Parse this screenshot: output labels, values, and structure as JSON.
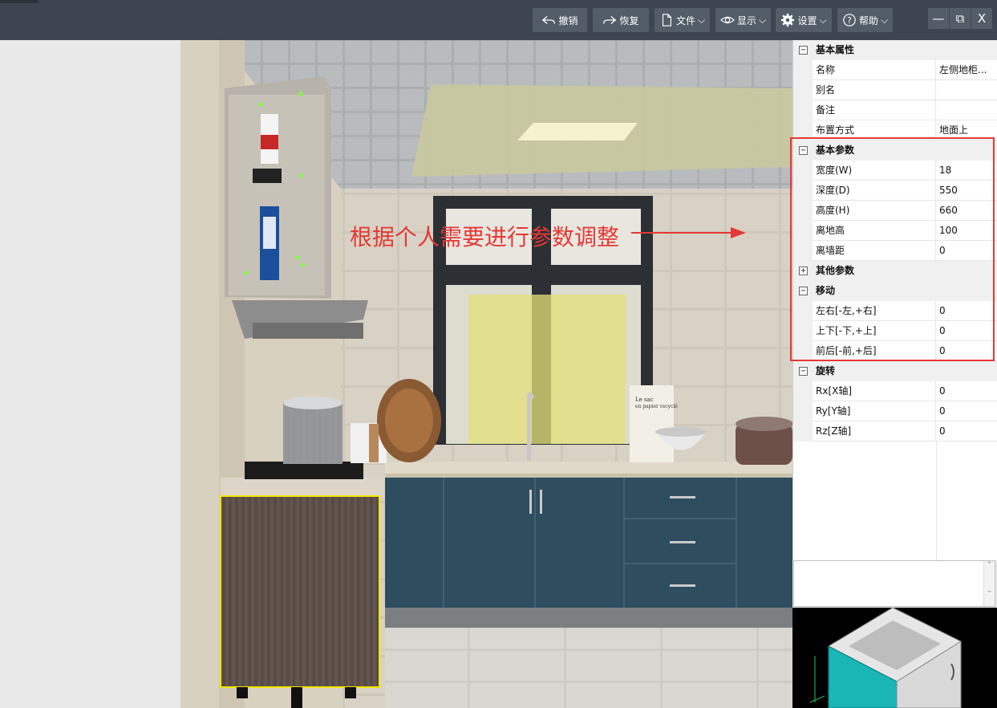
{
  "toolbar": {
    "undo_label": "撤销",
    "redo_label": "恢复",
    "file_label": "文件",
    "display_label": "显示",
    "settings_label": "设置",
    "help_label": "帮助"
  },
  "window_controls": {
    "minimize": "—",
    "restore": "⧉",
    "close": "X"
  },
  "annotation": {
    "text": "根据个人需要进行参数调整"
  },
  "properties": {
    "basic_attributes": {
      "title": "基本属性",
      "rows": [
        {
          "name": "名称",
          "value": "左侧地柜..."
        },
        {
          "name": "别名",
          "value": ""
        },
        {
          "name": "备注",
          "value": ""
        },
        {
          "name": "布置方式",
          "value": "地面上"
        }
      ]
    },
    "basic_params": {
      "title": "基本参数",
      "rows": [
        {
          "name": "宽度(W)",
          "value": "18"
        },
        {
          "name": "深度(D)",
          "value": "550"
        },
        {
          "name": "高度(H)",
          "value": "660"
        },
        {
          "name": "离地高",
          "value": "100"
        },
        {
          "name": "离墙距",
          "value": "0"
        }
      ]
    },
    "other_params": {
      "title": "其他参数"
    },
    "move": {
      "title": "移动",
      "rows": [
        {
          "name": "左右[-左,+右]",
          "value": "0"
        },
        {
          "name": "上下[-下,+上]",
          "value": "0"
        },
        {
          "name": "前后[-前,+后]",
          "value": "0"
        }
      ]
    },
    "rotate": {
      "title": "旋转",
      "rows": [
        {
          "name": "Rx[X轴]",
          "value": "0"
        },
        {
          "name": "Ry[Y轴]",
          "value": "0"
        },
        {
          "name": "Rz[Z轴]",
          "value": "0"
        }
      ]
    },
    "collapse_symbol": "⊟",
    "expand_symbol": "⊞"
  },
  "scene": {
    "bag_label_line1": "Le sac",
    "bag_label_line2": "en papier recyclé"
  },
  "icons": {
    "undo": "undo-icon",
    "redo": "redo-icon",
    "file": "file-icon",
    "display": "eye-icon",
    "settings": "gear-icon",
    "help": "help-icon"
  },
  "colors": {
    "topbar": "#3d4650",
    "button": "#525d68",
    "annotation_red": "#e53935",
    "selection_yellow": "#f2e600",
    "cabinet_teal": "#2e4d5e",
    "preview_cyan": "#1ab5b5"
  }
}
